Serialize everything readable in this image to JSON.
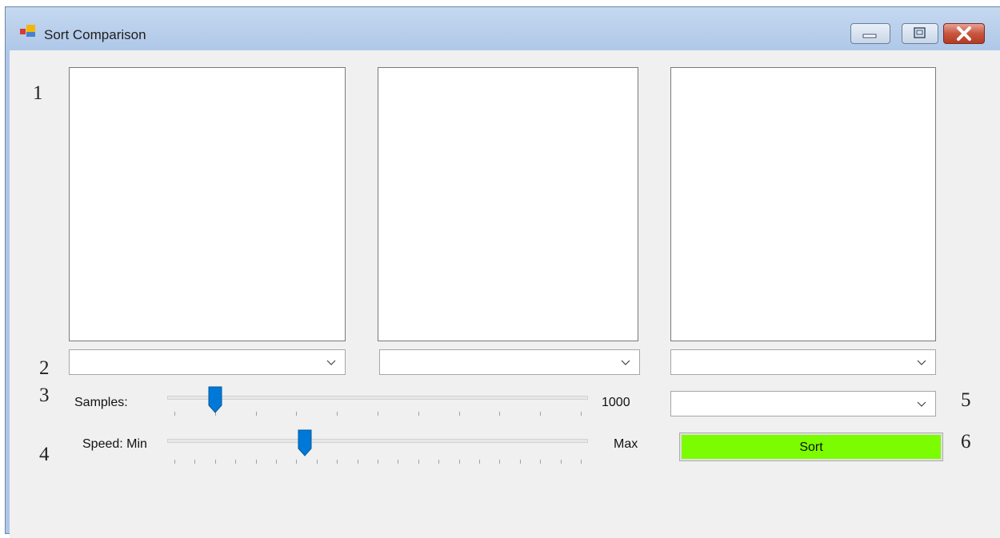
{
  "window": {
    "title": "Sort Comparison"
  },
  "annotations": [
    "1",
    "2",
    "3",
    "4",
    "5",
    "6"
  ],
  "panels": [
    {
      "name": "list-1"
    },
    {
      "name": "list-2"
    },
    {
      "name": "list-3"
    }
  ],
  "algorithm_dropdowns": [
    {
      "value": ""
    },
    {
      "value": ""
    },
    {
      "value": ""
    }
  ],
  "samples": {
    "label": "Samples:",
    "value_label": "1000",
    "slider_fraction": 0.1,
    "tick_count": 11
  },
  "speed": {
    "label": "Speed: Min",
    "max_label": "Max",
    "slider_fraction": 0.32,
    "tick_count": 21
  },
  "extra_dropdown": {
    "value": ""
  },
  "sort_button": {
    "label": "Sort",
    "color": "#7cfc00"
  },
  "icons": [
    "app-icon",
    "minimize-icon",
    "maximize-icon",
    "close-icon",
    "chevron-down-icon"
  ]
}
